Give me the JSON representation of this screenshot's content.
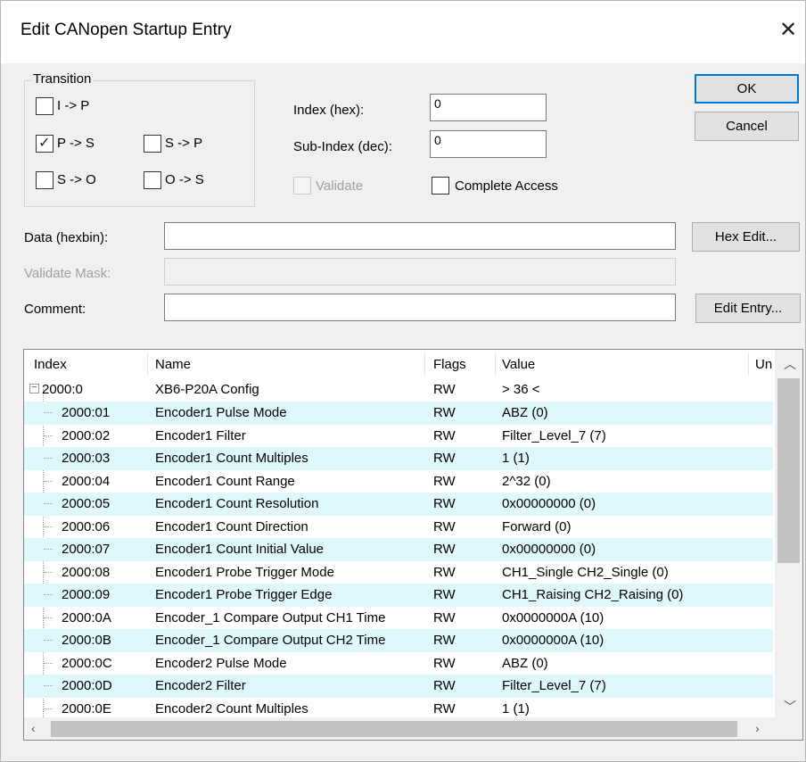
{
  "window": {
    "title": "Edit CANopen Startup Entry",
    "close_glyph": "✕"
  },
  "transition": {
    "legend": "Transition",
    "i_p": {
      "label": "I -> P",
      "checked": false
    },
    "p_s": {
      "label": "P -> S",
      "checked": true
    },
    "s_p": {
      "label": "S -> P",
      "checked": false
    },
    "s_o": {
      "label": "S -> O",
      "checked": false
    },
    "o_s": {
      "label": "O -> S",
      "checked": false
    }
  },
  "index": {
    "label": "Index (hex):",
    "value": "0"
  },
  "subindex": {
    "label": "Sub-Index (dec):",
    "value": "0"
  },
  "validate": {
    "label": "Validate",
    "checked": false,
    "disabled": true
  },
  "complete_access": {
    "label": "Complete Access",
    "checked": false
  },
  "buttons": {
    "ok": "OK",
    "cancel": "Cancel",
    "hex_edit": "Hex Edit...",
    "edit_entry": "Edit Entry..."
  },
  "data_field": {
    "label": "Data (hexbin):",
    "value": ""
  },
  "validate_mask": {
    "label": "Validate Mask:",
    "value": ""
  },
  "comment": {
    "label": "Comment:",
    "value": ""
  },
  "table": {
    "headers": {
      "index": "Index",
      "name": "Name",
      "flags": "Flags",
      "value": "Value",
      "unit": "Un"
    },
    "parent": {
      "index": "2000:0",
      "name": "XB6-P20A Config",
      "flags": "RW",
      "value": "> 36 <"
    },
    "rows": [
      {
        "index": "2000:01",
        "name": "Encoder1 Pulse Mode",
        "flags": "RW",
        "value": "ABZ (0)"
      },
      {
        "index": "2000:02",
        "name": "Encoder1 Filter",
        "flags": "RW",
        "value": "Filter_Level_7 (7)"
      },
      {
        "index": "2000:03",
        "name": "Encoder1 Count Multiples",
        "flags": "RW",
        "value": "1 (1)"
      },
      {
        "index": "2000:04",
        "name": "Encoder1 Count Range",
        "flags": "RW",
        "value": "2^32 (0)"
      },
      {
        "index": "2000:05",
        "name": "Encoder1 Count Resolution",
        "flags": "RW",
        "value": "0x00000000 (0)"
      },
      {
        "index": "2000:06",
        "name": "Encoder1 Count Direction",
        "flags": "RW",
        "value": "Forward (0)"
      },
      {
        "index": "2000:07",
        "name": "Encoder1 Count Initial Value",
        "flags": "RW",
        "value": "0x00000000 (0)"
      },
      {
        "index": "2000:08",
        "name": "Encoder1 Probe Trigger Mode",
        "flags": "RW",
        "value": "CH1_Single CH2_Single (0)"
      },
      {
        "index": "2000:09",
        "name": "Encoder1 Probe Trigger Edge",
        "flags": "RW",
        "value": "CH1_Raising CH2_Raising (0)"
      },
      {
        "index": "2000:0A",
        "name": "Encoder_1 Compare Output CH1 Time",
        "flags": "RW",
        "value": "0x0000000A (10)"
      },
      {
        "index": "2000:0B",
        "name": "Encoder_1 Compare Output CH2 Time",
        "flags": "RW",
        "value": "0x0000000A (10)"
      },
      {
        "index": "2000:0C",
        "name": "Encoder2 Pulse Mode",
        "flags": "RW",
        "value": "ABZ (0)"
      },
      {
        "index": "2000:0D",
        "name": "Encoder2 Filter",
        "flags": "RW",
        "value": "Filter_Level_7 (7)"
      },
      {
        "index": "2000:0E",
        "name": "Encoder2 Count Multiples",
        "flags": "RW",
        "value": "1 (1)"
      }
    ]
  },
  "colors": {
    "row_highlight": "#dff8fb",
    "default_button_border": "#0078d7"
  }
}
